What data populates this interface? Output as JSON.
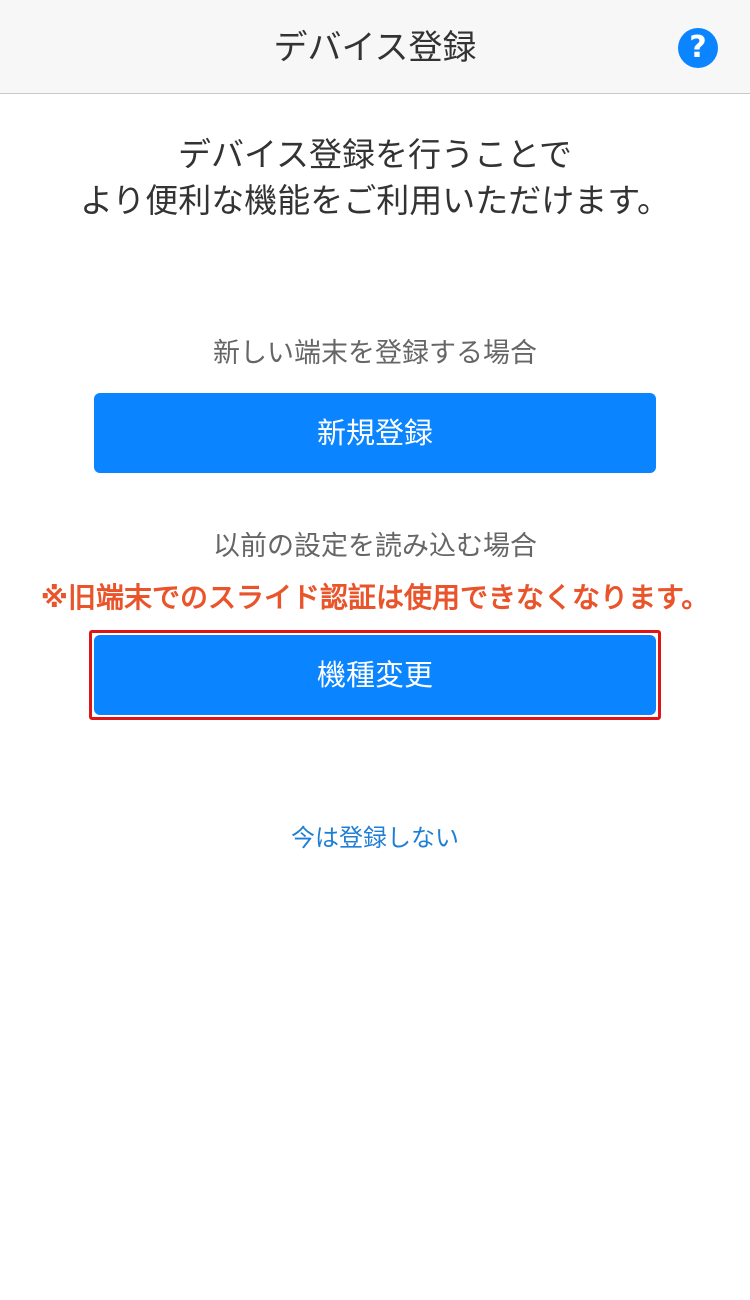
{
  "header": {
    "title": "デバイス登録",
    "help_icon": "question-circle-icon",
    "help_glyph": "?"
  },
  "intro": {
    "line1": "デバイス登録を行うことで",
    "line2": "より便利な機能をご利用いただけます。"
  },
  "new_device": {
    "label": "新しい端末を登録する場合",
    "button_label": "新規登録"
  },
  "existing_device": {
    "label": "以前の設定を読み込む場合",
    "warning": "※旧端末でのスライド認証は使用できなくなります。",
    "button_label": "機種変更"
  },
  "skip": {
    "label": "今は登録しない"
  },
  "colors": {
    "accent": "#0a84ff",
    "warning": "#e9542a",
    "highlight": "#e01616",
    "link": "#1f7fd6"
  }
}
